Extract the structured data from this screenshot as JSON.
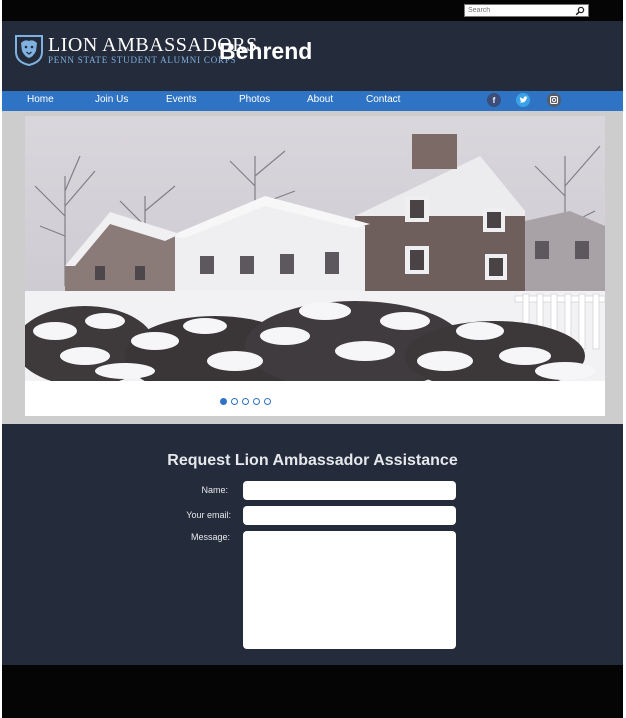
{
  "search": {
    "placeholder": "Search"
  },
  "brand": {
    "title": "LION AMBASSADORS",
    "subtitle": "PENN STATE STUDENT ALUMNI CORPS",
    "campus": "Behrend"
  },
  "nav": {
    "items": [
      {
        "label": "Home"
      },
      {
        "label": "Join Us"
      },
      {
        "label": "Events"
      },
      {
        "label": "Photos"
      },
      {
        "label": "About"
      },
      {
        "label": "Contact"
      }
    ],
    "social": [
      {
        "icon": "facebook-icon",
        "glyph": "f"
      },
      {
        "icon": "twitter-icon",
        "glyph": "t"
      },
      {
        "icon": "instagram-icon",
        "glyph": "◎"
      }
    ]
  },
  "slider": {
    "slide_count": 5,
    "active_index": 0
  },
  "form": {
    "title": "Request Lion Ambassador Assistance",
    "name_label": "Name:",
    "email_label": "Your email:",
    "message_label": "Message:",
    "name_value": "",
    "email_value": "",
    "message_value": ""
  },
  "colors": {
    "nav_blue": "#2f74c4",
    "header_navy": "#242b3b",
    "logo_accent": "#7fb2e0"
  }
}
